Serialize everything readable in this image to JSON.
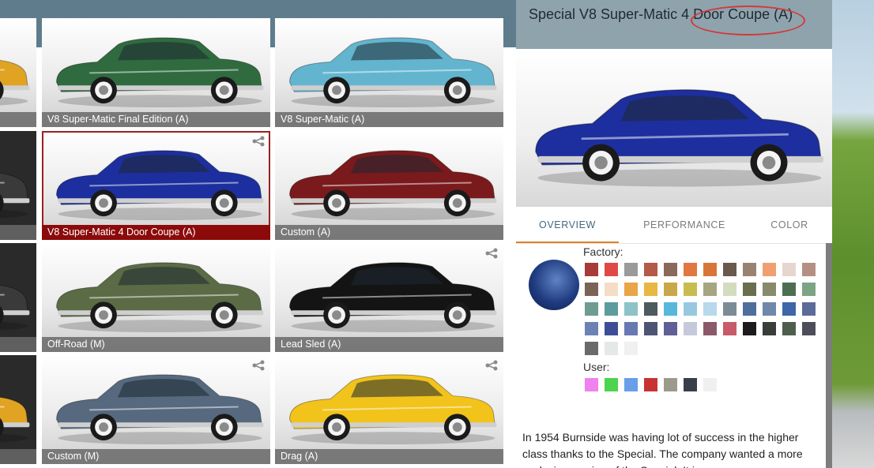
{
  "grid": {
    "tiles": [
      {
        "label": "V8 Super-Matic Final Edition (A)",
        "color": "#2f6b3f",
        "shared": false
      },
      {
        "label": "V8 Super-Matic (A)",
        "color": "#63b5cf",
        "shared": false
      },
      {
        "label": "V8 Super-Matic 4 Door Coupe (A)",
        "color": "#1d2f9e",
        "shared": true,
        "selected": true
      },
      {
        "label": "Custom (A)",
        "color": "#7a1a1c",
        "shared": false
      },
      {
        "label": "Off-Road (M)",
        "color": "#5b6b46",
        "shared": false
      },
      {
        "label": "Lead Sled (A)",
        "color": "#141414",
        "shared": true
      },
      {
        "label": "Custom (M)",
        "color": "#56697e",
        "shared": true
      },
      {
        "label": "Drag (A)",
        "color": "#f2c31b",
        "shared": true
      }
    ],
    "partial_colors": [
      "#e0a422",
      "#3a3a3a",
      "#3a3a3a",
      "#e0a422"
    ]
  },
  "panel": {
    "title": "Special V8 Super-Matic 4 Door Coupe (A)",
    "car_color": "#1d2f9e",
    "tabs": [
      {
        "label": "OVERVIEW",
        "active": true
      },
      {
        "label": "PERFORMANCE",
        "active": false
      },
      {
        "label": "COLOR",
        "active": false
      }
    ],
    "factory_label": "Factory:",
    "factory_colors": [
      "#a83a3a",
      "#e04848",
      "#9a9a9a",
      "#b35a48",
      "#8a6a5a",
      "#e07840",
      "#d8763a",
      "#6a5a4e",
      "#9a8272",
      "#f0a070",
      "#e6d6d0",
      "#b49082",
      "#7a6458",
      "#f4ddc6",
      "#e8a648",
      "#e8b844",
      "#c8a84a",
      "#c8bc50",
      "#a6a682",
      "#d4dcc0",
      "#6a6e4e",
      "#888a6c",
      "#4e6e52",
      "#7ea486",
      "#6e9c90",
      "#5c9c9c",
      "#8cc2c8",
      "#4e5a5e",
      "#58b8dc",
      "#98c8e0",
      "#b8d8ec",
      "#7c8c96",
      "#4e6e9c",
      "#7088aa",
      "#3e66a8",
      "#5c6c98",
      "#6c82b4",
      "#3e4e96",
      "#6878b2",
      "#4e5474",
      "#5e6096",
      "#c6c8dc",
      "#8a5a6a",
      "#c85a6a",
      "#1c1c1c",
      "#3a3e3a",
      "#4e5e4e",
      "#4e4e5a",
      "#6a6a6a",
      "#e4e8e8",
      "#f0f0f0"
    ],
    "user_label": "User:",
    "user_colors": [
      "#ee82ee",
      "#4cd44c",
      "#6a9ee8",
      "#c83232",
      "#9c9a8c",
      "#3a3e4a",
      "#f0f0f0"
    ],
    "description": "In 1954 Burnside was having lot of success in the higher class thanks to the Special. The company wanted a more exclusive version of the Special. It is"
  }
}
